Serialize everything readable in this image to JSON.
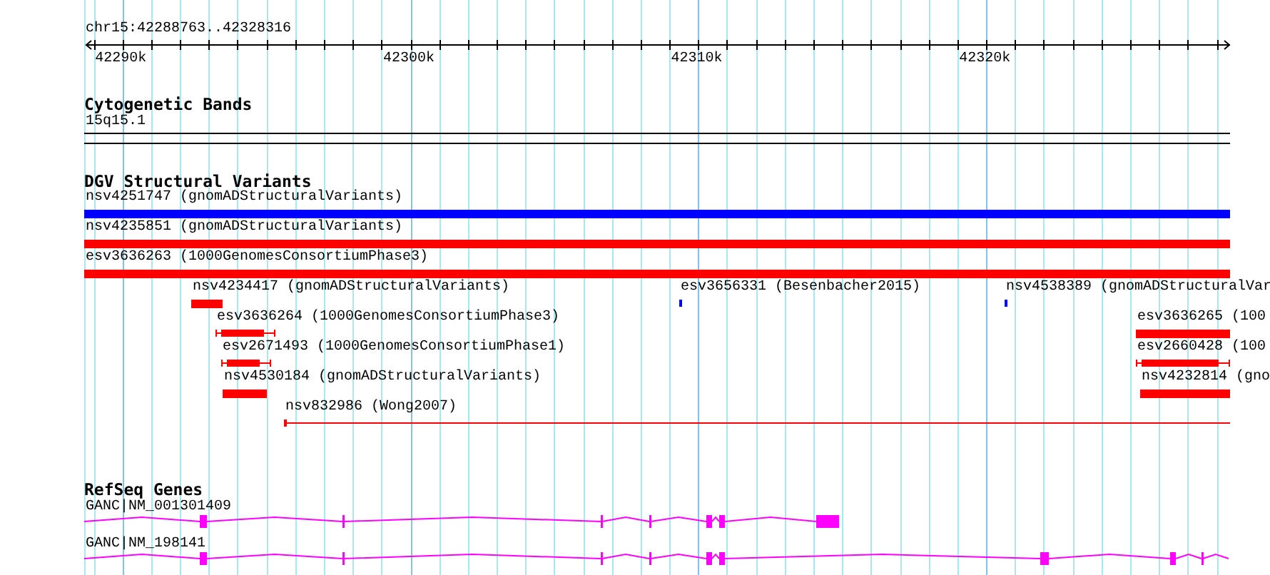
{
  "ruler": {
    "location": "chr15:42288763..42328316",
    "ticks": [
      "42290k",
      "42300k",
      "42310k",
      "42320k"
    ]
  },
  "tracks": [
    {
      "title": "Cytogenetic Bands",
      "kind": "bands",
      "features": [
        {
          "label": "15q15.1"
        }
      ]
    },
    {
      "title": "DGV Structural Variants",
      "kind": "variants",
      "features": [
        {
          "label": "nsv4251747 (gnomADStructuralVariants)",
          "color": "#0000ff"
        },
        {
          "label": "nsv4235851 (gnomADStructuralVariants)",
          "color": "#ff0000"
        },
        {
          "label": "esv3636263 (1000GenomesConsortiumPhase3)",
          "color": "#ff0000"
        },
        {
          "label": "nsv4234417 (gnomADStructuralVariants)",
          "color": "#ff0000"
        },
        {
          "label": "esv3656331 (Besenbacher2015)",
          "color": "#0000ff"
        },
        {
          "label": "nsv4538389 (gnomADStructuralVar",
          "color": "#0000ff"
        },
        {
          "label": "esv3636264 (1000GenomesConsortiumPhase3)",
          "color": "#ff0000"
        },
        {
          "label": "esv3636265 (100",
          "color": "#ff0000"
        },
        {
          "label": "esv2671493 (1000GenomesConsortiumPhase1)",
          "color": "#ff0000"
        },
        {
          "label": "esv2660428 (100",
          "color": "#ff0000"
        },
        {
          "label": "nsv4530184 (gnomADStructuralVariants)",
          "color": "#ff0000"
        },
        {
          "label": "nsv4232814 (gno",
          "color": "#ff0000"
        },
        {
          "label": "nsv832986 (Wong2007)",
          "color": "#ff0000"
        }
      ]
    },
    {
      "title": "RefSeq Genes",
      "kind": "genes",
      "features": [
        {
          "label": "GANC|NM_001301409"
        },
        {
          "label": "GANC|NM_198141"
        }
      ]
    }
  ]
}
